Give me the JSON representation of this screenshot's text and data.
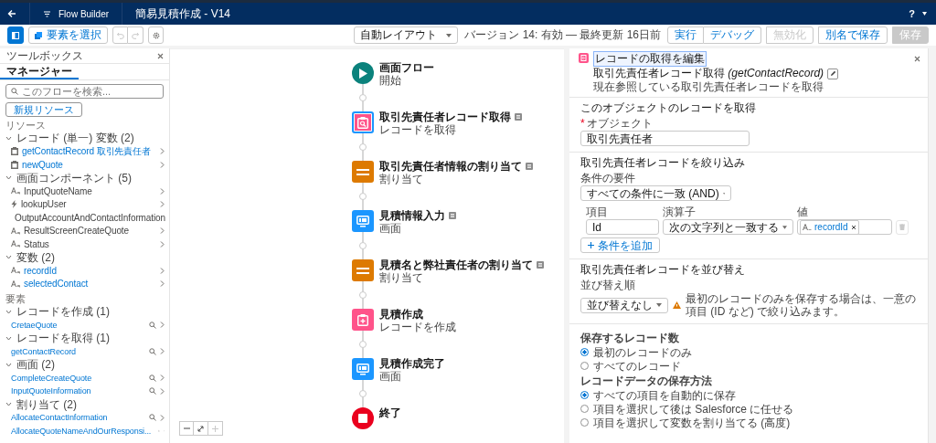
{
  "top_bar": {
    "app_name": "Flow Builder",
    "flow_title": "簡易見積作成 - V14",
    "help": "?"
  },
  "toolbar": {
    "select_button": "要素を選択",
    "undo_disabled": true,
    "redo_disabled": true,
    "layout": "自動レイアウト",
    "version_info": "バージョン 14: 有効 — 最終更新 16日前",
    "button_groups": [
      [
        {
          "label": "実行",
          "disabled": false
        },
        {
          "label": "デバッグ",
          "disabled": false
        }
      ],
      [
        {
          "label": "無効化",
          "disabled": true
        }
      ],
      [
        {
          "label": "別名で保存",
          "disabled": false
        }
      ],
      [
        {
          "label": "保存",
          "disabled": true
        }
      ]
    ]
  },
  "toolbox": {
    "title": "ツールボックス",
    "tabs": [
      {
        "label": "マネージャー",
        "selected": true
      }
    ],
    "search": {
      "placeholder": "このフローを検索..."
    },
    "new_resource_button": "新規リソース",
    "sections": [
      {
        "title": "リソース",
        "kind": "resources",
        "groups": [
          {
            "label": "レコード (単一) 変数 (2)",
            "expanded": true,
            "children": [
              {
                "name": "getContactRecord 取引先責任者",
                "kind": "record",
                "link": true
              },
              {
                "name": "newQuote",
                "kind": "record",
                "link": true
              }
            ]
          },
          {
            "label": "画面コンポーネント (5)",
            "expanded": true,
            "children": [
              {
                "name": "InputQuoteName",
                "kind": "text",
                "link": false
              },
              {
                "name": "lookupUser",
                "kind": "lookup",
                "link": false
              },
              {
                "name": "OutputAccountAndContactInformation",
                "kind": "text",
                "link": false
              },
              {
                "name": "ResultScreenCreateQuote",
                "kind": "text",
                "link": false
              },
              {
                "name": "Status",
                "kind": "text",
                "link": false
              }
            ]
          },
          {
            "label": "変数 (2)",
            "expanded": true,
            "children": [
              {
                "name": "recordId",
                "kind": "text",
                "link": true
              },
              {
                "name": "selectedContact",
                "kind": "text",
                "link": true
              }
            ]
          }
        ]
      },
      {
        "title": "要素",
        "kind": "elements",
        "groups": [
          {
            "label": "レコードを作成 (1)",
            "expanded": true,
            "children": [
              {
                "name": "CretaeQuote",
                "link": true
              }
            ]
          },
          {
            "label": "レコードを取得 (1)",
            "expanded": true,
            "children": [
              {
                "name": "getContactRecord",
                "link": true
              }
            ]
          },
          {
            "label": "画面 (2)",
            "expanded": true,
            "children": [
              {
                "name": "CompleteCreateQuote",
                "link": true
              },
              {
                "name": "InputQuoteInformation",
                "link": true
              }
            ]
          },
          {
            "label": "割り当て (2)",
            "expanded": true,
            "children": [
              {
                "name": "AllocateContactInformation",
                "link": true
              },
              {
                "name": "AllocateQuoteNameAndOurResponsi...",
                "link": true
              }
            ]
          }
        ]
      }
    ]
  },
  "canvas": {
    "nodes": [
      {
        "kind": "start",
        "title": "画面フロー",
        "subtitle": "開始",
        "selected": false,
        "note": false
      },
      {
        "kind": "get_record",
        "title": "取引先責任者レコード取得",
        "subtitle": "レコードを取得",
        "selected": true,
        "note": true
      },
      {
        "kind": "assignment",
        "title": "取引先責任者情報の割り当て",
        "subtitle": "割り当て",
        "selected": false,
        "note": true
      },
      {
        "kind": "screen",
        "title": "見積情報入力",
        "subtitle": "画面",
        "selected": false,
        "note": true
      },
      {
        "kind": "assignment",
        "title": "見積名と弊社責任者の割り当て",
        "subtitle": "割り当て",
        "selected": false,
        "note": true
      },
      {
        "kind": "create_record",
        "title": "見積作成",
        "subtitle": "レコードを作成",
        "selected": false,
        "note": false
      },
      {
        "kind": "screen",
        "title": "見積作成完了",
        "subtitle": "画面",
        "selected": false,
        "note": false
      },
      {
        "kind": "end",
        "title": "終了",
        "selected": false,
        "note": false
      }
    ],
    "zoom_in_disabled": true
  },
  "editor": {
    "title": "レコードの取得を編集",
    "name": "取引先責任者レコード取得 *(getContactRecord)*",
    "description": "現在参照している取引先責任者レコードを取得",
    "object_section": {
      "title": "このオブジェクトのレコードを取得",
      "label": "オブジェクト",
      "required": true,
      "required_mark": "*",
      "value": "取引先責任者"
    },
    "filter_section": {
      "title": "取引先責任者レコードを絞り込み",
      "requirement_label": "条件の要件",
      "requirement": "すべての条件に一致 (AND)",
      "columns": [
        "項目",
        "演算子",
        "値"
      ],
      "conditions": [
        {
          "field": "Id",
          "operator": "次の文字列と一致する",
          "value": "recordId"
        }
      ],
      "add_button": "条件を追加"
    },
    "sort_section": {
      "title": "取引先責任者レコードを並び替え",
      "label": "並び替え順",
      "value": "並び替えなし",
      "warning": "最初のレコードのみを保存する場合は、一意の項目 (ID など) で絞り込みます。"
    },
    "count": {
      "label": "保存するレコード数",
      "options": [
        {
          "label": "最初のレコードのみ",
          "selected": true
        },
        {
          "label": "すべてのレコード",
          "selected": false
        }
      ]
    },
    "storage": {
      "label": "レコードデータの保存方法",
      "options": [
        {
          "label": "すべての項目を自動的に保存",
          "selected": true
        },
        {
          "label": "項目を選択して後は Salesforce に任せる",
          "selected": false
        },
        {
          "label": "項目を選択して変数を割り当てる (高度)",
          "selected": false
        }
      ]
    }
  }
}
